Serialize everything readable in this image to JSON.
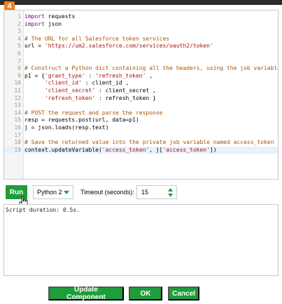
{
  "header": {
    "step_number": "4"
  },
  "editor": {
    "lines": [
      {
        "n": "1",
        "tokens": [
          {
            "t": "kw",
            "v": "import"
          },
          {
            "t": "tx",
            "v": " requests"
          }
        ]
      },
      {
        "n": "2",
        "tokens": [
          {
            "t": "kw",
            "v": "import"
          },
          {
            "t": "tx",
            "v": " json"
          }
        ]
      },
      {
        "n": "3",
        "tokens": []
      },
      {
        "n": "4",
        "tokens": [
          {
            "t": "cm",
            "v": "# The URL for all Salesforce token services"
          }
        ]
      },
      {
        "n": "5",
        "tokens": [
          {
            "t": "tx",
            "v": "url = "
          },
          {
            "t": "str",
            "v": "'https://um2.salesforce.com/services/oauth2/token'"
          }
        ]
      },
      {
        "n": "6",
        "tokens": []
      },
      {
        "n": "7",
        "tokens": []
      },
      {
        "n": "8",
        "tokens": [
          {
            "t": "cm",
            "v": "# Construct a Python dict containing all the headers, using the job variables"
          }
        ]
      },
      {
        "n": "9",
        "tokens": [
          {
            "t": "tx",
            "v": "p1 = {"
          },
          {
            "t": "str",
            "v": "'grant_type'"
          },
          {
            "t": "tx",
            "v": " : "
          },
          {
            "t": "str",
            "v": "'refresh_token'"
          },
          {
            "t": "tx",
            "v": " ,"
          }
        ]
      },
      {
        "n": "10",
        "tokens": [
          {
            "t": "tx",
            "v": "      "
          },
          {
            "t": "str",
            "v": "'client_id'"
          },
          {
            "t": "tx",
            "v": " : client_id ,"
          }
        ]
      },
      {
        "n": "11",
        "tokens": [
          {
            "t": "tx",
            "v": "      "
          },
          {
            "t": "str",
            "v": "'client_secret'"
          },
          {
            "t": "tx",
            "v": " : client_secret ,"
          }
        ]
      },
      {
        "n": "12",
        "tokens": [
          {
            "t": "tx",
            "v": "      "
          },
          {
            "t": "str",
            "v": "'refresh_token'"
          },
          {
            "t": "tx",
            "v": " : refresh_token }"
          }
        ]
      },
      {
        "n": "13",
        "tokens": []
      },
      {
        "n": "14",
        "tokens": [
          {
            "t": "cm",
            "v": "# POST the request and parse the response"
          }
        ]
      },
      {
        "n": "15",
        "tokens": [
          {
            "t": "tx",
            "v": "resp = requests.post(url, data=p1)"
          }
        ]
      },
      {
        "n": "16",
        "tokens": [
          {
            "t": "tx",
            "v": "j = json.loads(resp.text)"
          }
        ]
      },
      {
        "n": "17",
        "tokens": []
      },
      {
        "n": "18",
        "tokens": [
          {
            "t": "cm",
            "v": "# Save the returned value into the private job variable named access_token"
          }
        ]
      },
      {
        "n": "19",
        "active": true,
        "tokens": [
          {
            "t": "tx",
            "v": "context.updateVariable("
          },
          {
            "t": "str",
            "v": "'access_token'"
          },
          {
            "t": "tx",
            "v": ", j["
          },
          {
            "t": "str",
            "v": "'access_token'"
          },
          {
            "t": "tx",
            "v": "])"
          }
        ]
      }
    ]
  },
  "toolbar": {
    "run_label": "Run",
    "language": "Python 2",
    "timeout_label": "Timeout (seconds):",
    "timeout_value": "15"
  },
  "output": {
    "text": "Script duration: 0.5s."
  },
  "footer": {
    "update_label": "Update Component",
    "ok_label": "OK",
    "cancel_label": "Cancel"
  },
  "colors": {
    "accent_green": "#1f9d3a",
    "step_badge": "#f0811d",
    "comment": "#aa5500",
    "string": "#aa1111",
    "keyword": "#770088"
  },
  "icons": {
    "dropdown": "chevron-down-icon",
    "spinner": "spinner-arrows-icon",
    "cursor": "hand-pointer-icon"
  }
}
